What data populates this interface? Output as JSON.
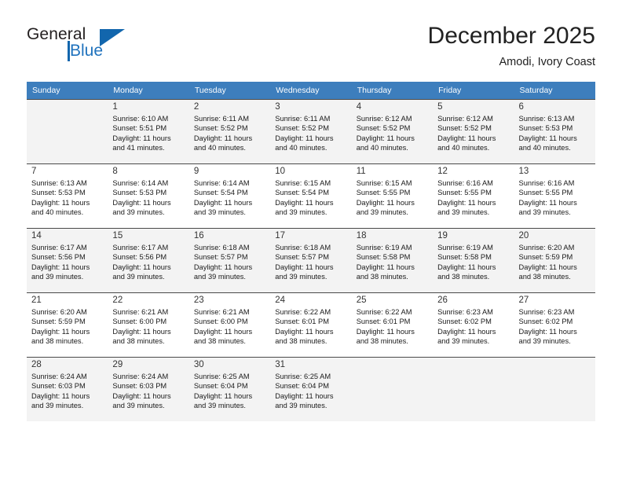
{
  "brand": {
    "name_top": "General",
    "name_bottom": "Blue",
    "accent_color": "#1266ad"
  },
  "header": {
    "title": "December 2025",
    "location": "Amodi, Ivory Coast"
  },
  "calendar": {
    "header_bg": "#3d7ebd",
    "weekday_headers": [
      "Sunday",
      "Monday",
      "Tuesday",
      "Wednesday",
      "Thursday",
      "Friday",
      "Saturday"
    ],
    "weeks": [
      [
        {
          "day": "",
          "info": ""
        },
        {
          "day": "1",
          "info": "Sunrise: 6:10 AM\nSunset: 5:51 PM\nDaylight: 11 hours\nand 41 minutes."
        },
        {
          "day": "2",
          "info": "Sunrise: 6:11 AM\nSunset: 5:52 PM\nDaylight: 11 hours\nand 40 minutes."
        },
        {
          "day": "3",
          "info": "Sunrise: 6:11 AM\nSunset: 5:52 PM\nDaylight: 11 hours\nand 40 minutes."
        },
        {
          "day": "4",
          "info": "Sunrise: 6:12 AM\nSunset: 5:52 PM\nDaylight: 11 hours\nand 40 minutes."
        },
        {
          "day": "5",
          "info": "Sunrise: 6:12 AM\nSunset: 5:52 PM\nDaylight: 11 hours\nand 40 minutes."
        },
        {
          "day": "6",
          "info": "Sunrise: 6:13 AM\nSunset: 5:53 PM\nDaylight: 11 hours\nand 40 minutes."
        }
      ],
      [
        {
          "day": "7",
          "info": "Sunrise: 6:13 AM\nSunset: 5:53 PM\nDaylight: 11 hours\nand 40 minutes."
        },
        {
          "day": "8",
          "info": "Sunrise: 6:14 AM\nSunset: 5:53 PM\nDaylight: 11 hours\nand 39 minutes."
        },
        {
          "day": "9",
          "info": "Sunrise: 6:14 AM\nSunset: 5:54 PM\nDaylight: 11 hours\nand 39 minutes."
        },
        {
          "day": "10",
          "info": "Sunrise: 6:15 AM\nSunset: 5:54 PM\nDaylight: 11 hours\nand 39 minutes."
        },
        {
          "day": "11",
          "info": "Sunrise: 6:15 AM\nSunset: 5:55 PM\nDaylight: 11 hours\nand 39 minutes."
        },
        {
          "day": "12",
          "info": "Sunrise: 6:16 AM\nSunset: 5:55 PM\nDaylight: 11 hours\nand 39 minutes."
        },
        {
          "day": "13",
          "info": "Sunrise: 6:16 AM\nSunset: 5:55 PM\nDaylight: 11 hours\nand 39 minutes."
        }
      ],
      [
        {
          "day": "14",
          "info": "Sunrise: 6:17 AM\nSunset: 5:56 PM\nDaylight: 11 hours\nand 39 minutes."
        },
        {
          "day": "15",
          "info": "Sunrise: 6:17 AM\nSunset: 5:56 PM\nDaylight: 11 hours\nand 39 minutes."
        },
        {
          "day": "16",
          "info": "Sunrise: 6:18 AM\nSunset: 5:57 PM\nDaylight: 11 hours\nand 39 minutes."
        },
        {
          "day": "17",
          "info": "Sunrise: 6:18 AM\nSunset: 5:57 PM\nDaylight: 11 hours\nand 39 minutes."
        },
        {
          "day": "18",
          "info": "Sunrise: 6:19 AM\nSunset: 5:58 PM\nDaylight: 11 hours\nand 38 minutes."
        },
        {
          "day": "19",
          "info": "Sunrise: 6:19 AM\nSunset: 5:58 PM\nDaylight: 11 hours\nand 38 minutes."
        },
        {
          "day": "20",
          "info": "Sunrise: 6:20 AM\nSunset: 5:59 PM\nDaylight: 11 hours\nand 38 minutes."
        }
      ],
      [
        {
          "day": "21",
          "info": "Sunrise: 6:20 AM\nSunset: 5:59 PM\nDaylight: 11 hours\nand 38 minutes."
        },
        {
          "day": "22",
          "info": "Sunrise: 6:21 AM\nSunset: 6:00 PM\nDaylight: 11 hours\nand 38 minutes."
        },
        {
          "day": "23",
          "info": "Sunrise: 6:21 AM\nSunset: 6:00 PM\nDaylight: 11 hours\nand 38 minutes."
        },
        {
          "day": "24",
          "info": "Sunrise: 6:22 AM\nSunset: 6:01 PM\nDaylight: 11 hours\nand 38 minutes."
        },
        {
          "day": "25",
          "info": "Sunrise: 6:22 AM\nSunset: 6:01 PM\nDaylight: 11 hours\nand 38 minutes."
        },
        {
          "day": "26",
          "info": "Sunrise: 6:23 AM\nSunset: 6:02 PM\nDaylight: 11 hours\nand 39 minutes."
        },
        {
          "day": "27",
          "info": "Sunrise: 6:23 AM\nSunset: 6:02 PM\nDaylight: 11 hours\nand 39 minutes."
        }
      ],
      [
        {
          "day": "28",
          "info": "Sunrise: 6:24 AM\nSunset: 6:03 PM\nDaylight: 11 hours\nand 39 minutes."
        },
        {
          "day": "29",
          "info": "Sunrise: 6:24 AM\nSunset: 6:03 PM\nDaylight: 11 hours\nand 39 minutes."
        },
        {
          "day": "30",
          "info": "Sunrise: 6:25 AM\nSunset: 6:04 PM\nDaylight: 11 hours\nand 39 minutes."
        },
        {
          "day": "31",
          "info": "Sunrise: 6:25 AM\nSunset: 6:04 PM\nDaylight: 11 hours\nand 39 minutes."
        },
        {
          "day": "",
          "info": ""
        },
        {
          "day": "",
          "info": ""
        },
        {
          "day": "",
          "info": ""
        }
      ]
    ]
  }
}
